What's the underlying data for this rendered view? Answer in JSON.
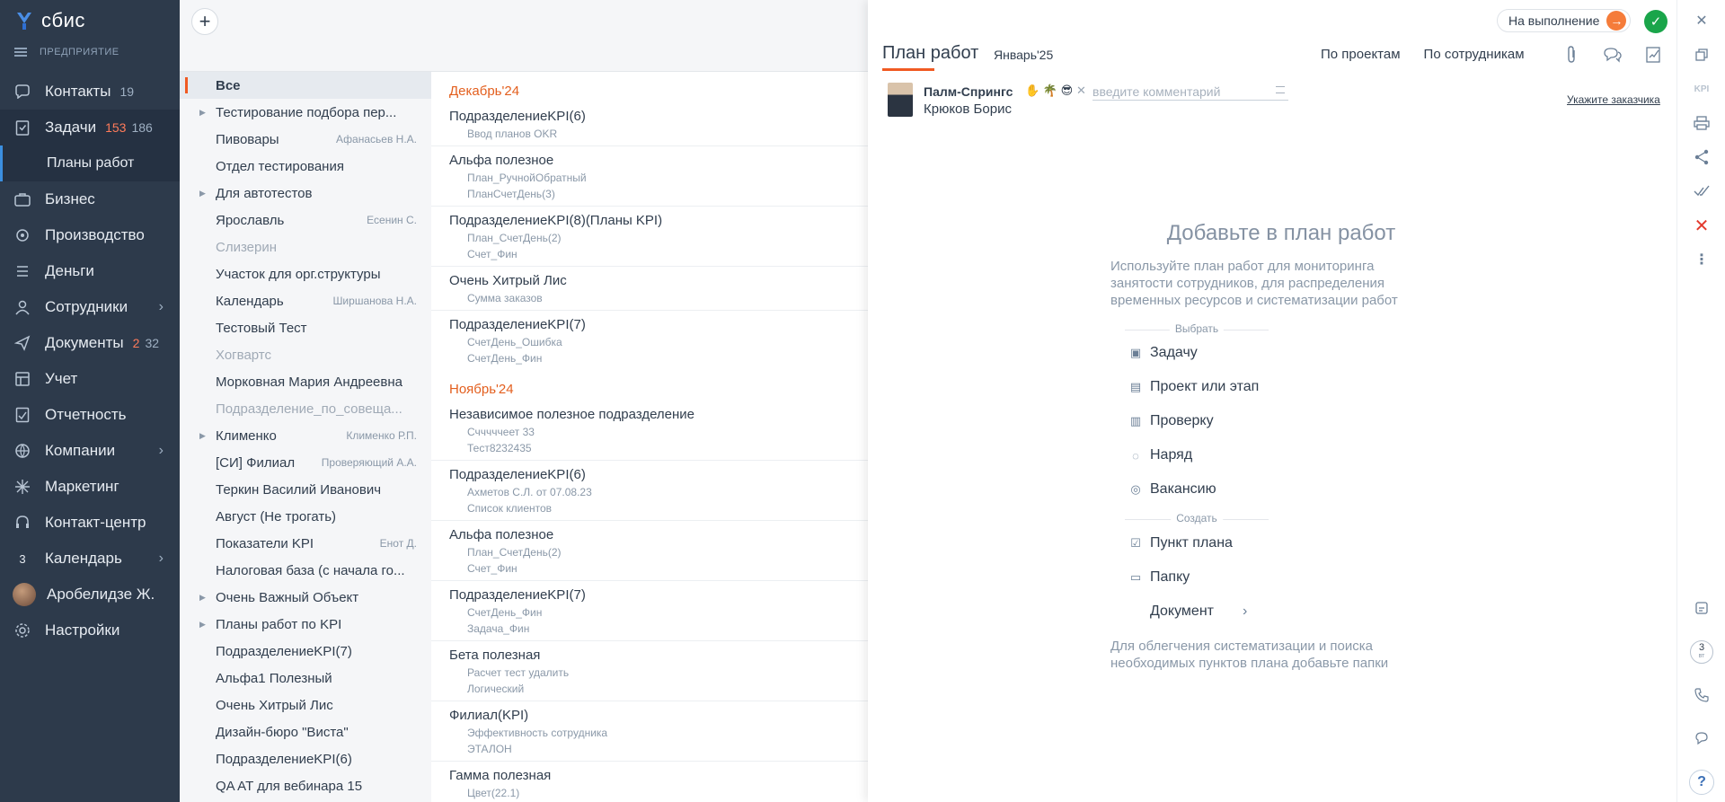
{
  "nav": {
    "logo": "сбис",
    "company": "ПРЕДПРИЯТИЕ",
    "items": [
      {
        "label": "Контакты",
        "count": "19",
        "icon": "contacts-icon"
      },
      {
        "label": "Задачи",
        "count_red": "153",
        "count": "186",
        "icon": "tasks-icon"
      },
      {
        "label": "Планы работ"
      },
      {
        "label": "Бизнес",
        "icon": "business-icon"
      },
      {
        "label": "Производство",
        "icon": "production-icon"
      },
      {
        "label": "Деньги",
        "icon": "money-icon"
      },
      {
        "label": "Сотрудники",
        "icon": "employees-icon"
      },
      {
        "label": "Документы",
        "count_red": "2",
        "count": "32",
        "icon": "documents-icon"
      },
      {
        "label": "Учет",
        "icon": "accounting-icon"
      },
      {
        "label": "Отчетность",
        "icon": "reports-icon"
      },
      {
        "label": "Компании",
        "icon": "companies-icon"
      },
      {
        "label": "Маркетинг",
        "icon": "marketing-icon"
      },
      {
        "label": "Контакт-центр",
        "icon": "contact-center-icon"
      },
      {
        "label": "Календарь",
        "icon": "calendar-icon",
        "cal_day": "3"
      },
      {
        "label": "Аробелидзе Ж."
      },
      {
        "label": "Настройки",
        "icon": "settings-icon"
      }
    ]
  },
  "folders": [
    {
      "label": "Все"
    },
    {
      "label": "Тестирование подбора пер..."
    },
    {
      "label": "Пивовары",
      "who": "Афанасьев Н.А."
    },
    {
      "label": "Отдел тестирования"
    },
    {
      "label": "Для автотестов"
    },
    {
      "label": "Ярославль",
      "who": "Есенин С."
    },
    {
      "label": "Слизерин"
    },
    {
      "label": "Участок для орг.структуры"
    },
    {
      "label": "Календарь",
      "who": "Ширшанова Н.А."
    },
    {
      "label": "Тестовый Тест"
    },
    {
      "label": "Хогвартс"
    },
    {
      "label": "Морковная Мария Андреевна"
    },
    {
      "label": "Подразделение_по_совеща..."
    },
    {
      "label": "Клименко",
      "who": "Клименко Р.П."
    },
    {
      "label": "[СИ] Филиал",
      "who": "Проверяющий А.А."
    },
    {
      "label": "Теркин Василий Иванович"
    },
    {
      "label": "Август (Не трогать)"
    },
    {
      "label": "Показатели KPI",
      "who": "Енот Д."
    },
    {
      "label": "Налоговая база (с начала го..."
    },
    {
      "label": "Очень Важный Объект"
    },
    {
      "label": "Планы работ по KPI"
    },
    {
      "label": "ПодразделениеKPI(7)"
    },
    {
      "label": "Альфа1 Полезный"
    },
    {
      "label": "Очень Хитрый Лис"
    },
    {
      "label": "Дизайн-бюро \"Виста\""
    },
    {
      "label": "ПодразделениеKPI(6)"
    },
    {
      "label": "QA AT для вебинара 15"
    }
  ],
  "plans": {
    "dec": "Декабрь'24",
    "nov": "Ноябрь'24",
    "dec_items": [
      {
        "title": "ПодразделениеKPI(6)",
        "subs": [
          "Ввод планов OKR"
        ]
      },
      {
        "title": "Альфа полезное",
        "subs": [
          "План_РучнойОбратный",
          "ПланСчетДень(3)"
        ]
      },
      {
        "title": "ПодразделениеKPI(8)(Планы KPI)",
        "subs": [
          "План_СчетДень(2)",
          "Счет_Фин"
        ]
      },
      {
        "title": "Очень Хитрый Лис",
        "subs": [
          "Сумма заказов"
        ]
      },
      {
        "title": "ПодразделениеKPI(7)",
        "subs": [
          "СчетДень_Ошибка",
          "СчетДень_Фин"
        ]
      }
    ],
    "nov_items": [
      {
        "title": "Независимое полезное подразделение",
        "subs": [
          "Счччччеет 33",
          "Тест8232435"
        ]
      },
      {
        "title": "ПодразделениеKPI(6)",
        "subs": [
          "Ахметов С.Л. от 07.08.23",
          "Список клиентов"
        ]
      },
      {
        "title": "Альфа полезное",
        "subs": [
          "План_СчетДень(2)",
          "Счет_Фин"
        ]
      },
      {
        "title": "ПодразделениеKPI(7)",
        "subs": [
          "СчетДень_Фин",
          "Задача_Фин"
        ]
      },
      {
        "title": "Бета полезная",
        "subs": [
          "Расчет тест удалить",
          "Логический"
        ]
      },
      {
        "title": "Филиал(KPI)",
        "subs": [
          "Эффективность сотрудника",
          "ЭТАЛОН"
        ]
      },
      {
        "title": "Гамма полезная",
        "subs": [
          "Цвет(22.1)"
        ]
      }
    ]
  },
  "panel": {
    "title": "План работ",
    "period": "Январь'25",
    "status": "На выполнение",
    "tab_projects": "По проектам",
    "tab_employees": "По сотрудникам",
    "org": "Палм-Спрингс",
    "org_emoji": "✋ 🌴 😎",
    "comment_placeholder": "введите комментарий",
    "employee": "Крюков Борис",
    "customer": "Укажите заказчика",
    "empty_title": "Добавьте в план работ",
    "empty_hint": "Используйте план работ для мониторинга занятости сотрудников, для распределения временных ресурсов и систематизации работ",
    "choose": "Выбрать",
    "create": "Создать",
    "opt_task": "Задачу",
    "opt_project": "Проект или этап",
    "opt_check": "Проверку",
    "opt_order": "Наряд",
    "opt_vacancy": "Вакансию",
    "opt_point": "Пункт плана",
    "opt_folder": "Папку",
    "opt_document": "Документ",
    "empty_foot": "Для облегчения систематизации и поиска необходимых пунктов плана добавьте папки"
  },
  "rbar": {
    "kpi": "KPI",
    "day": "3",
    "weekday": "вт",
    "help": "?"
  },
  "colors": {
    "accent": "#f05a22",
    "nav_bg": "#2d3a4b",
    "ok": "#1aa54a"
  }
}
